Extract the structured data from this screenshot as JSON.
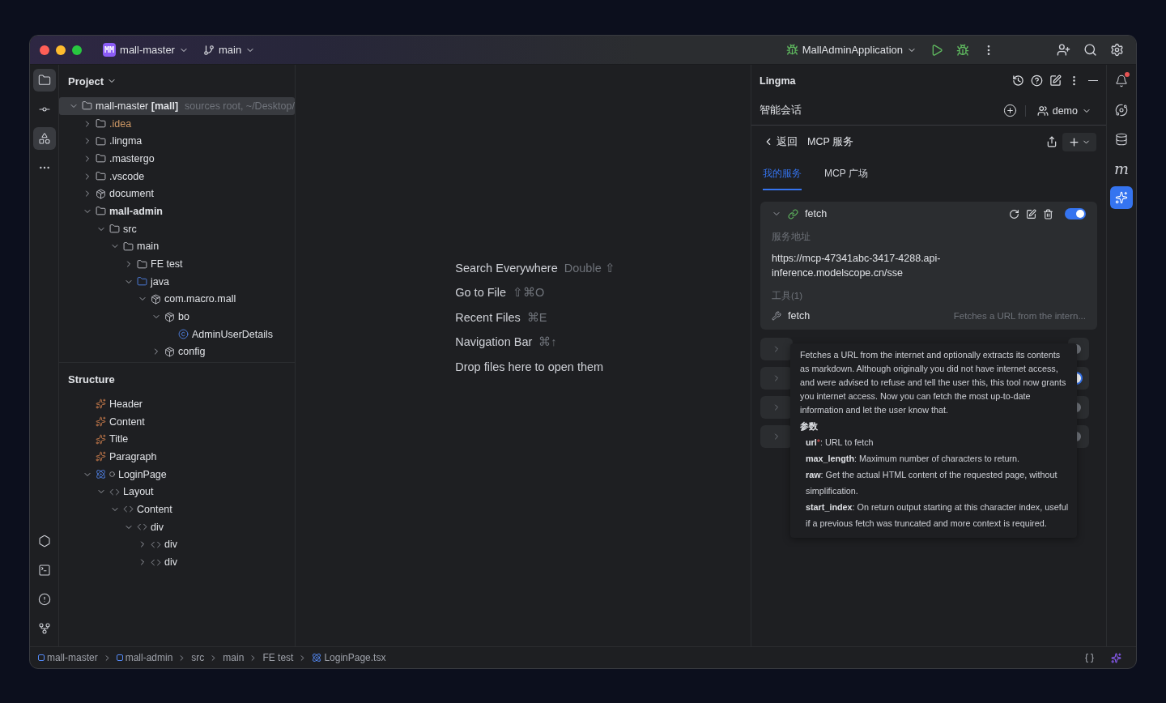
{
  "title_bar": {
    "project_badge": "MM",
    "project": "mall-master",
    "branch": "main",
    "run_config": "MallAdminApplication"
  },
  "activity_bar": {
    "top": [
      {
        "kind": "folder",
        "selected": true
      },
      {
        "kind": "commit",
        "selected": false
      },
      {
        "kind": "structure",
        "selected": true
      },
      {
        "kind": "more",
        "selected": false
      }
    ],
    "bottom": [
      {
        "kind": "run",
        "selected": false
      },
      {
        "kind": "terminal",
        "selected": false
      },
      {
        "kind": "problems",
        "selected": false
      },
      {
        "kind": "git",
        "selected": false
      }
    ]
  },
  "project_panel": {
    "title": "Project",
    "tree": [
      {
        "label": "mall-master **[mall]**",
        "hint": "sources root, ~/Desktop/",
        "kind": "root",
        "selected": true,
        "expanded": true,
        "children": [
          {
            "label": ".idea",
            "kind": "excluded",
            "selected": false,
            "expanded": false
          },
          {
            "label": ".lingma",
            "kind": "folder",
            "selected": false,
            "expanded": false
          },
          {
            "label": ".mastergo",
            "kind": "folder",
            "selected": false,
            "expanded": false
          },
          {
            "label": ".vscode",
            "kind": "folder",
            "selected": false,
            "expanded": false
          },
          {
            "label": "document",
            "kind": "package",
            "selected": false,
            "expanded": false
          },
          {
            "label": "mall-admin",
            "kind": "module",
            "selected": false,
            "expanded": true,
            "children": [
              {
                "label": "src",
                "kind": "folder",
                "selected": false,
                "expanded": true,
                "children": [
                  {
                    "label": "main",
                    "kind": "folder",
                    "selected": false,
                    "expanded": true,
                    "children": [
                      {
                        "label": "FE test",
                        "kind": "folder",
                        "selected": false,
                        "expanded": false
                      },
                      {
                        "label": "java",
                        "kind": "source",
                        "selected": false,
                        "expanded": true,
                        "children": [
                          {
                            "label": "com.macro.mall",
                            "kind": "package",
                            "selected": false,
                            "expanded": true,
                            "children": [
                              {
                                "label": "bo",
                                "kind": "package",
                                "selected": false,
                                "expanded": true,
                                "children": [
                                  {
                                    "label": "AdminUserDetails",
                                    "kind": "class",
                                    "selected": false
                                  }
                                ]
                              },
                              {
                                "label": "config",
                                "kind": "package",
                                "selected": false,
                                "expanded": false
                              }
                            ]
                          }
                        ]
                      }
                    ]
                  }
                ]
              }
            ]
          }
        ]
      }
    ]
  },
  "structure_panel": {
    "title": "Structure",
    "tree": [
      {
        "label": "Header",
        "kind": "vue"
      },
      {
        "label": "Content",
        "kind": "vue"
      },
      {
        "label": "Title",
        "kind": "vue"
      },
      {
        "label": "Paragraph",
        "kind": "vue"
      },
      {
        "label": "LoginPage",
        "kind": "react",
        "expanded": true,
        "children": [
          {
            "label": "Layout",
            "kind": "tag",
            "expanded": true,
            "children": [
              {
                "label": "Content",
                "kind": "tag",
                "expanded": true,
                "children": [
                  {
                    "label": "div",
                    "kind": "tag",
                    "expanded": true,
                    "children": [
                      {
                        "label": "div",
                        "kind": "tag",
                        "expanded": false
                      },
                      {
                        "label": "div",
                        "kind": "tag",
                        "expanded": false
                      }
                    ]
                  }
                ]
              }
            ]
          }
        ]
      }
    ]
  },
  "editor_hints": [
    {
      "label": "Search Everywhere",
      "shortcut": "Double ⇧"
    },
    {
      "label": "Go to File",
      "shortcut": "⇧⌘O"
    },
    {
      "label": "Recent Files",
      "shortcut": "⌘E"
    },
    {
      "label": "Navigation Bar",
      "shortcut": "⌘↑"
    },
    {
      "label": "Drop files here to open them"
    }
  ],
  "lingma": {
    "title": "Lingma",
    "session": "智能会话",
    "user": "demo",
    "back": "返回",
    "page_title": "MCP 服务",
    "tabs": [
      {
        "label": "我的服务",
        "selected": true
      },
      {
        "label": "MCP 广场",
        "selected": false
      }
    ],
    "server": {
      "name": "fetch",
      "expanded": true,
      "on": true,
      "address_label": "服务地址",
      "address": "https://mcp-47341abc-3417-4288.api-inference.modelscope.cn/sse",
      "tools_label": "工具(1)",
      "tools": [
        {
          "name": "fetch",
          "description": "Fetches a URL from the intern..."
        }
      ]
    },
    "other_servers": [
      {
        "on": false
      },
      {
        "on": true
      },
      {
        "on": false
      },
      {
        "on": false
      }
    ],
    "tooltip": {
      "description": "Fetches a URL from the internet and optionally extracts its contents as markdown. Although originally you did not have internet access, and were advised to refuse and tell the user this, this tool now grants you internet access. Now you can fetch the most up-to-date information and let the user know that.",
      "params_label": "参数",
      "params": [
        {
          "name": "url",
          "required_mark": "*",
          "description": ": URL to fetch"
        },
        {
          "name": "max_length",
          "description": ": Maximum number of characters to return."
        },
        {
          "name": "raw",
          "description": ": Get the actual HTML content of the requested page, without simplification."
        },
        {
          "name": "start_index",
          "description": ": On return output starting at this character index, useful if a previous fetch was truncated and more context is required."
        }
      ]
    }
  },
  "right_strip": [
    {
      "kind": "bell",
      "selected": false,
      "alert": true
    },
    {
      "kind": "spiral",
      "selected": false,
      "alert": false
    },
    {
      "kind": "database",
      "selected": false,
      "alert": false
    },
    {
      "kind": "m",
      "selected": false,
      "alert": false
    },
    {
      "kind": "lingma",
      "selected": true,
      "alert": false
    }
  ],
  "breadcrumb": [
    {
      "label": "mall-master",
      "kind": "module"
    },
    {
      "label": "mall-admin",
      "kind": "module"
    },
    {
      "label": "src",
      "kind": "plain"
    },
    {
      "label": "main",
      "kind": "plain"
    },
    {
      "label": "FE test",
      "kind": "plain"
    },
    {
      "label": "LoginPage.tsx",
      "kind": "react"
    }
  ]
}
